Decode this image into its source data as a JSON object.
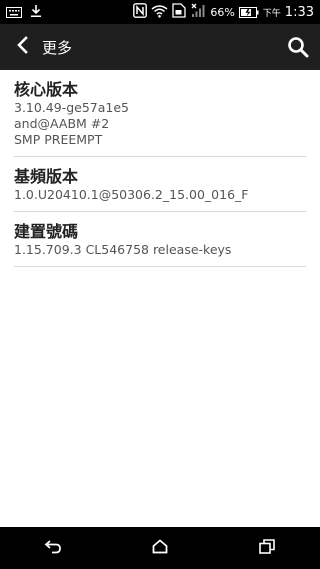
{
  "status_bar": {
    "battery_percent": "66%",
    "ampm": "下午",
    "time": "1:33",
    "icons": [
      "keyboard-icon",
      "download-icon",
      "nfc-icon",
      "wifi-icon",
      "sim-icon",
      "signal-icon",
      "battery-icon"
    ]
  },
  "action_bar": {
    "title": "更多",
    "back_icon": "back-arrow-icon",
    "search_icon": "search-icon"
  },
  "items": [
    {
      "title": "核心版本",
      "values": [
        "3.10.49-ge57a1e5",
        "and@AABM #2",
        "SMP PREEMPT"
      ]
    },
    {
      "title": "基頻版本",
      "values": [
        "1.0.U20410.1@50306.2_15.00_016_F"
      ]
    },
    {
      "title": "建置號碼",
      "values": [
        "1.15.709.3 CL546758 release-keys"
      ]
    }
  ],
  "nav_bar": {
    "icons": [
      "back-icon",
      "home-icon",
      "recent-apps-icon"
    ]
  },
  "colors": {
    "status_bar": "#000000",
    "action_bar": "#1f1f1f",
    "background": "#ffffff",
    "divider": "#d9d9d9"
  }
}
